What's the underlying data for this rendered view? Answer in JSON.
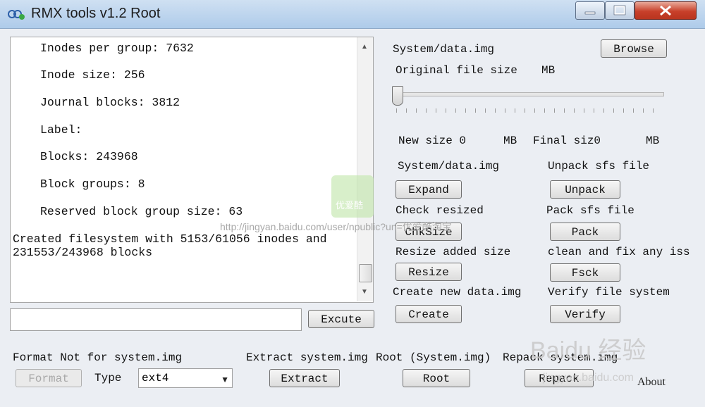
{
  "window": {
    "title": "RMX tools v1.2 Root"
  },
  "output": {
    "lines": [
      "Inodes per group: 7632",
      "Inode size: 256",
      "Journal blocks: 3812",
      "Label:",
      "Blocks: 243968",
      "Block groups: 8",
      "Reserved block group size: 63",
      "Created filesystem with 5153/61056 inodes and",
      "231553/243968 blocks"
    ]
  },
  "command": {
    "value": "",
    "execute_label": "Excute"
  },
  "image_panel": {
    "file_label": "System/data.img",
    "browse_label": "Browse",
    "original_size_label": "Original file size",
    "original_size_unit": "MB",
    "new_size_label": "New size 0",
    "new_size_unit": "MB",
    "final_size_label": "Final siz0",
    "final_size_unit": "MB"
  },
  "actions": {
    "expand": {
      "label": "System/data.img",
      "button": "Expand"
    },
    "unpack": {
      "label": "Unpack sfs file",
      "button": "Unpack"
    },
    "chksize": {
      "label": "Check resized",
      "button": "ChkSize"
    },
    "pack": {
      "label": "Pack sfs file",
      "button": "Pack"
    },
    "resize": {
      "label": "Resize added size",
      "button": "Resize"
    },
    "fsck": {
      "label": "clean and fix any iss",
      "button": "Fsck"
    },
    "create": {
      "label": "Create new data.img",
      "button": "Create"
    },
    "verify": {
      "label": "Verify file system",
      "button": "Verify"
    }
  },
  "bottom": {
    "format_label": "Format Not for system.img",
    "format_button": "Format",
    "type_label": "Type",
    "type_value": "ext4",
    "extract_label": "Extract system.img",
    "extract_button": "Extract",
    "root_label": "Root (System.img)",
    "root_button": "Root",
    "repack_label": "Repack system.img",
    "repack_button": "Repack",
    "about_label": "About"
  },
  "watermark": {
    "url": "http://jingyan.baidu.com/user/npublic?un=优爱酷淘宝",
    "logo_text": "优爱酷",
    "baidu_text": "Baidu 经验",
    "baidu_sub": "jingyan.baidu.com"
  }
}
